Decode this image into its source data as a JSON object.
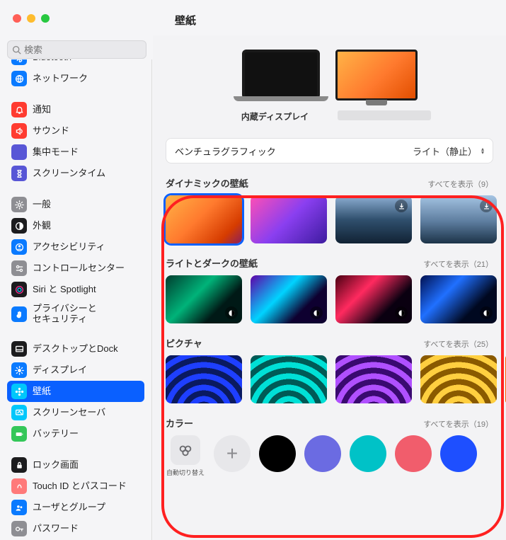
{
  "window": {
    "title": "壁紙"
  },
  "search": {
    "placeholder": "検索"
  },
  "sidebar": [
    {
      "name": "bluetooth",
      "label": "Bluetooth",
      "icon_bg": "#0a7aff",
      "glyph": "bt"
    },
    {
      "name": "network",
      "label": "ネットワーク",
      "icon_bg": "#0a7aff",
      "glyph": "globe"
    },
    {
      "name": "notifications",
      "label": "通知",
      "icon_bg": "#ff3b30",
      "glyph": "bell"
    },
    {
      "name": "sound",
      "label": "サウンド",
      "icon_bg": "#ff3b30",
      "glyph": "speaker"
    },
    {
      "name": "focus",
      "label": "集中モード",
      "icon_bg": "#5856d6",
      "glyph": "moon"
    },
    {
      "name": "screentime",
      "label": "スクリーンタイム",
      "icon_bg": "#5856d6",
      "glyph": "hourglass"
    },
    {
      "name": "general",
      "label": "一般",
      "icon_bg": "#8e8e93",
      "glyph": "gear"
    },
    {
      "name": "appearance",
      "label": "外観",
      "icon_bg": "#1c1c1e",
      "glyph": "appearance"
    },
    {
      "name": "accessibility",
      "label": "アクセシビリティ",
      "icon_bg": "#0a7aff",
      "glyph": "person"
    },
    {
      "name": "controlcenter",
      "label": "コントロールセンター",
      "icon_bg": "#8e8e93",
      "glyph": "switches"
    },
    {
      "name": "siri",
      "label": "Siri と Spotlight",
      "icon_bg": "#1c1c1e",
      "glyph": "siri"
    },
    {
      "name": "privacy",
      "label": "プライバシーと\nセキュリティ",
      "icon_bg": "#0a7aff",
      "glyph": "hand"
    },
    {
      "name": "desktop-dock",
      "label": "デスクトップとDock",
      "icon_bg": "#1c1c1e",
      "glyph": "dock"
    },
    {
      "name": "displays",
      "label": "ディスプレイ",
      "icon_bg": "#0a7aff",
      "glyph": "sun"
    },
    {
      "name": "wallpaper",
      "label": "壁紙",
      "icon_bg": "#00c7fb",
      "glyph": "flower",
      "selected": true
    },
    {
      "name": "screensaver",
      "label": "スクリーンセーバ",
      "icon_bg": "#00c7fb",
      "glyph": "screen"
    },
    {
      "name": "battery",
      "label": "バッテリー",
      "icon_bg": "#34c759",
      "glyph": "battery"
    },
    {
      "name": "lockscreen",
      "label": "ロック画面",
      "icon_bg": "#1c1c1e",
      "glyph": "lock"
    },
    {
      "name": "touchid",
      "label": "Touch ID とパスコード",
      "icon_bg": "#ff7a7a",
      "glyph": "finger"
    },
    {
      "name": "users",
      "label": "ユーザとグループ",
      "icon_bg": "#0a7aff",
      "glyph": "users"
    },
    {
      "name": "passwords",
      "label": "パスワード",
      "icon_bg": "#8e8e93",
      "glyph": "key"
    }
  ],
  "gaps_after": [
    "network",
    "screentime",
    "privacy",
    "battery"
  ],
  "preview": {
    "internal_label": "内蔵ディスプレイ",
    "external_label": ""
  },
  "current": {
    "name": "ベンチュラグラフィック",
    "mode": "ライト（静止）"
  },
  "show_all_prefix": "すべてを表示",
  "sections": [
    {
      "key": "dynamic",
      "title": "ダイナミックの壁紙",
      "count": 9,
      "items": [
        {
          "cls": "wp-ventura",
          "selected": true
        },
        {
          "cls": "wp-monterey"
        },
        {
          "cls": "wp-photo1",
          "download": true
        },
        {
          "cls": "wp-photo2",
          "download": true
        }
      ]
    },
    {
      "key": "lightdark",
      "title": "ライトとダークの壁紙",
      "count": 21,
      "items": [
        {
          "cls": "wp-dark1",
          "mode_icon": true
        },
        {
          "cls": "wp-dark2",
          "mode_icon": true
        },
        {
          "cls": "wp-dark3",
          "mode_icon": true
        },
        {
          "cls": "wp-dark4",
          "mode_icon": true
        }
      ]
    },
    {
      "key": "pictures",
      "title": "ピクチャ",
      "count": 25,
      "items": [
        {
          "cls": "wp-pic1"
        },
        {
          "cls": "wp-pic2"
        },
        {
          "cls": "wp-pic3"
        },
        {
          "cls": "wp-pic4"
        }
      ],
      "edge": "#ff5a00"
    },
    {
      "key": "colors",
      "title": "カラー",
      "count": 19
    }
  ],
  "colors": {
    "auto_label": "自動切り替え",
    "swatches": [
      "#000000",
      "#6b6be2",
      "#00c2c7",
      "#f15d6c",
      "#1e4fff"
    ]
  }
}
